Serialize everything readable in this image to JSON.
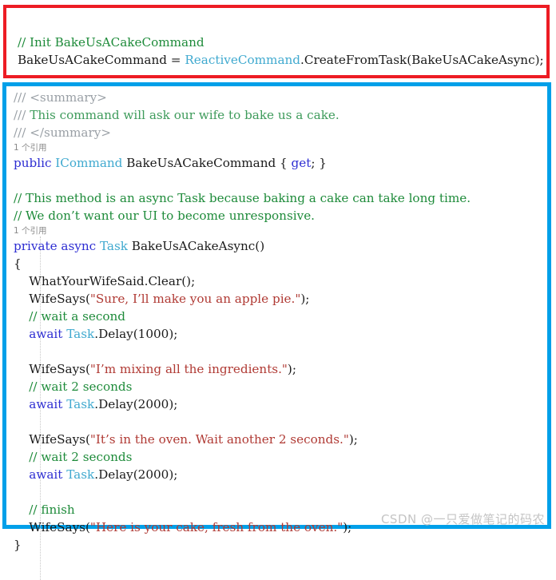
{
  "editor": {
    "language": "csharp",
    "theme": "visual-studio-light",
    "colors": {
      "comment": "#1E8B3A",
      "doc_comment": "#9AA0A6",
      "keyword": "#2D2DD2",
      "type": "#3FA9CF",
      "string": "#B03A34",
      "text": "#1A1A1A",
      "codelens": "#8A8A8A",
      "highlight_red": "#ED1C24",
      "highlight_blue": "#00A0E9",
      "watermark": "#C4C4C4"
    }
  },
  "snippet_top": {
    "title": "Init BakeUsACakeCommand",
    "lines": [
      {
        "tokens": [
          {
            "t": "// Init BakeUsACakeCommand",
            "c": "cmt"
          }
        ]
      },
      {
        "tokens": [
          {
            "t": "BakeUsACakeCommand ",
            "c": "id"
          },
          {
            "t": "= ",
            "c": "pun"
          },
          {
            "t": "ReactiveCommand",
            "c": "type"
          },
          {
            "t": ".",
            "c": "pun"
          },
          {
            "t": "CreateFromTask",
            "c": "id"
          },
          {
            "t": "(",
            "c": "pun"
          },
          {
            "t": "BakeUsACakeAsync",
            "c": "id"
          },
          {
            "t": ");",
            "c": "pun"
          }
        ]
      }
    ]
  },
  "snippet_main": {
    "lines": [
      {
        "tokens": [
          {
            "t": "/// ",
            "c": "doc"
          },
          {
            "t": "<summary>",
            "c": "doc"
          }
        ]
      },
      {
        "tokens": [
          {
            "t": "/// ",
            "c": "doc"
          },
          {
            "t": "This command will ask our wife to bake us a cake.",
            "c": "doctxt"
          }
        ]
      },
      {
        "tokens": [
          {
            "t": "/// ",
            "c": "doc"
          },
          {
            "t": "</summary>",
            "c": "doc"
          }
        ]
      },
      {
        "codelens": "1 个引用"
      },
      {
        "tokens": [
          {
            "t": "public ",
            "c": "kw"
          },
          {
            "t": "ICommand ",
            "c": "type"
          },
          {
            "t": "BakeUsACakeCommand ",
            "c": "id"
          },
          {
            "t": "{ ",
            "c": "pun"
          },
          {
            "t": "get",
            "c": "kw"
          },
          {
            "t": "; }",
            "c": "pun"
          }
        ]
      },
      {
        "blank": true
      },
      {
        "tokens": [
          {
            "t": "// This method is an async Task because baking a cake can take long time.",
            "c": "cmt"
          }
        ]
      },
      {
        "tokens": [
          {
            "t": "// We don’t want our UI to become unresponsive.",
            "c": "cmt"
          }
        ]
      },
      {
        "codelens": "1 个引用"
      },
      {
        "tokens": [
          {
            "t": "private ",
            "c": "kw"
          },
          {
            "t": "async ",
            "c": "kw"
          },
          {
            "t": "Task ",
            "c": "type"
          },
          {
            "t": "BakeUsACakeAsync",
            "c": "id"
          },
          {
            "t": "()",
            "c": "pun"
          }
        ]
      },
      {
        "tokens": [
          {
            "t": "{",
            "c": "pun"
          }
        ]
      },
      {
        "tokens": [
          {
            "t": "    WhatYourWifeSaid",
            "c": "id"
          },
          {
            "t": ".",
            "c": "pun"
          },
          {
            "t": "Clear",
            "c": "id"
          },
          {
            "t": "();",
            "c": "pun"
          }
        ]
      },
      {
        "tokens": [
          {
            "t": "    WifeSays",
            "c": "id"
          },
          {
            "t": "(",
            "c": "pun"
          },
          {
            "t": "\"Sure, I’ll make you an apple pie.\"",
            "c": "str"
          },
          {
            "t": ");",
            "c": "pun"
          }
        ]
      },
      {
        "tokens": [
          {
            "t": "    // wait a second",
            "c": "cmt"
          }
        ]
      },
      {
        "tokens": [
          {
            "t": "    await ",
            "c": "kw"
          },
          {
            "t": "Task",
            "c": "type"
          },
          {
            "t": ".",
            "c": "pun"
          },
          {
            "t": "Delay",
            "c": "id"
          },
          {
            "t": "(",
            "c": "pun"
          },
          {
            "t": "1000",
            "c": "num"
          },
          {
            "t": ");",
            "c": "pun"
          }
        ]
      },
      {
        "blank": true
      },
      {
        "tokens": [
          {
            "t": "    WifeSays",
            "c": "id"
          },
          {
            "t": "(",
            "c": "pun"
          },
          {
            "t": "\"I’m mixing all the ingredients.\"",
            "c": "str"
          },
          {
            "t": ");",
            "c": "pun"
          }
        ]
      },
      {
        "tokens": [
          {
            "t": "    // wait 2 seconds",
            "c": "cmt"
          }
        ]
      },
      {
        "tokens": [
          {
            "t": "    await ",
            "c": "kw"
          },
          {
            "t": "Task",
            "c": "type"
          },
          {
            "t": ".",
            "c": "pun"
          },
          {
            "t": "Delay",
            "c": "id"
          },
          {
            "t": "(",
            "c": "pun"
          },
          {
            "t": "2000",
            "c": "num"
          },
          {
            "t": ");",
            "c": "pun"
          }
        ]
      },
      {
        "blank": true
      },
      {
        "tokens": [
          {
            "t": "    WifeSays",
            "c": "id"
          },
          {
            "t": "(",
            "c": "pun"
          },
          {
            "t": "\"It’s in the oven. Wait another 2 seconds.\"",
            "c": "str"
          },
          {
            "t": ");",
            "c": "pun"
          }
        ]
      },
      {
        "tokens": [
          {
            "t": "    // wait 2 seconds",
            "c": "cmt"
          }
        ]
      },
      {
        "tokens": [
          {
            "t": "    await ",
            "c": "kw"
          },
          {
            "t": "Task",
            "c": "type"
          },
          {
            "t": ".",
            "c": "pun"
          },
          {
            "t": "Delay",
            "c": "id"
          },
          {
            "t": "(",
            "c": "pun"
          },
          {
            "t": "2000",
            "c": "num"
          },
          {
            "t": ");",
            "c": "pun"
          }
        ]
      },
      {
        "blank": true
      },
      {
        "tokens": [
          {
            "t": "    // finish",
            "c": "cmt"
          }
        ]
      },
      {
        "tokens": [
          {
            "t": "    WifeSays",
            "c": "id"
          },
          {
            "t": "(",
            "c": "pun"
          },
          {
            "t": "\"Here is your cake, fresh from the oven.\"",
            "c": "str"
          },
          {
            "t": ");",
            "c": "pun"
          }
        ]
      },
      {
        "tokens": [
          {
            "t": "}",
            "c": "pun"
          }
        ]
      }
    ]
  },
  "watermark": {
    "text": "CSDN @一只爱做笔记的码农"
  }
}
